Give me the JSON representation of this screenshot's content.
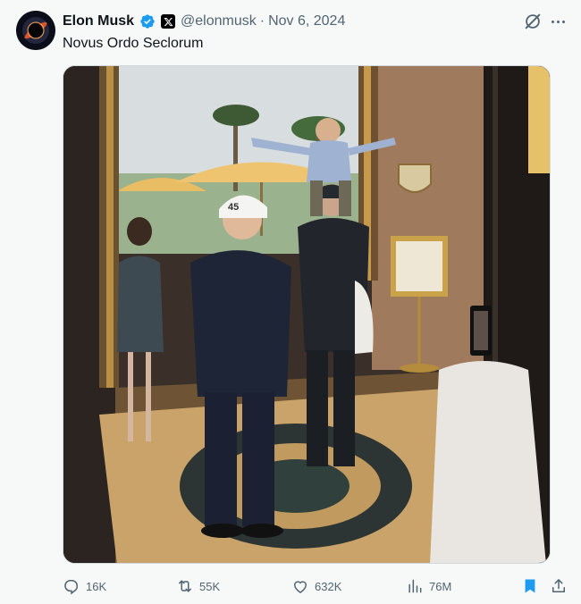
{
  "author": {
    "name": "Elon Musk",
    "handle": "@elonmusk",
    "separator": "·",
    "date": "Nov 6, 2024"
  },
  "tweet": {
    "text": "Novus Ordo Seclorum"
  },
  "photo": {
    "sign_text": "45"
  },
  "actions": {
    "replies": "16K",
    "reposts": "55K",
    "likes": "632K",
    "views": "76M"
  },
  "icons": {
    "verified": "verified-badge-icon",
    "affiliate": "x-logo-icon",
    "grok": "grok-icon",
    "more": "more-icon",
    "reply": "reply-icon",
    "repost": "repost-icon",
    "like": "heart-icon",
    "views": "views-icon",
    "bookmark": "bookmark-icon",
    "share": "share-icon"
  },
  "colors": {
    "text_primary": "#0f1419",
    "text_secondary": "#536471",
    "verified_blue": "#1d9bf0",
    "bookmark_active": "#1d9bf0",
    "background": "#f7f9f9"
  }
}
